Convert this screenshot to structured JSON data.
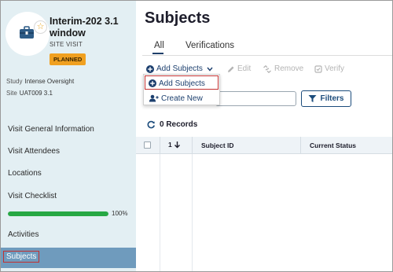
{
  "visit": {
    "title": "Interim-202 3.1 window",
    "type": "SITE VISIT",
    "status": "PLANNED",
    "study_label": "Study",
    "study_value": "Intense Oversight",
    "site_label": "Site",
    "site_value": "UAT009 3.1"
  },
  "sidebar": {
    "items": [
      {
        "label": "Visit General Information"
      },
      {
        "label": "Visit Attendees"
      },
      {
        "label": "Locations"
      },
      {
        "label": "Visit Checklist"
      },
      {
        "label": "Activities"
      },
      {
        "label": "Subjects"
      }
    ],
    "checklist_progress": 100,
    "checklist_progress_label": "100%"
  },
  "main": {
    "title": "Subjects",
    "tabs": [
      {
        "label": "All"
      },
      {
        "label": "Verifications"
      }
    ],
    "toolbar": {
      "add_label": "Add Subjects",
      "edit_label": "Edit",
      "remove_label": "Remove",
      "verify_label": "Verify"
    },
    "dropdown": {
      "add_label": "Add Subjects",
      "create_label": "Create New"
    },
    "search": {
      "value": "",
      "placeholder": ""
    },
    "filters_label": "Filters",
    "records_label": "0 Records",
    "table": {
      "columns": [
        "1",
        "Subject ID",
        "Current Status"
      ]
    }
  },
  "colors": {
    "sidebar_bg": "#e3eff3",
    "active_nav": "#6f9bbd",
    "status_badge": "#f0a020",
    "progress": "#27a844",
    "accent": "#1c3f6e",
    "highlight_border": "#c23030"
  },
  "icons": {
    "logo": "briefcase-icon",
    "favorite": "star-icon",
    "add": "plus-circle-icon",
    "edit": "pencil-icon",
    "remove": "unlink-icon",
    "verify": "verify-badge-icon",
    "filter": "funnel-icon",
    "refresh": "refresh-icon",
    "create": "person-add-icon",
    "sort": "arrow-down-icon"
  }
}
